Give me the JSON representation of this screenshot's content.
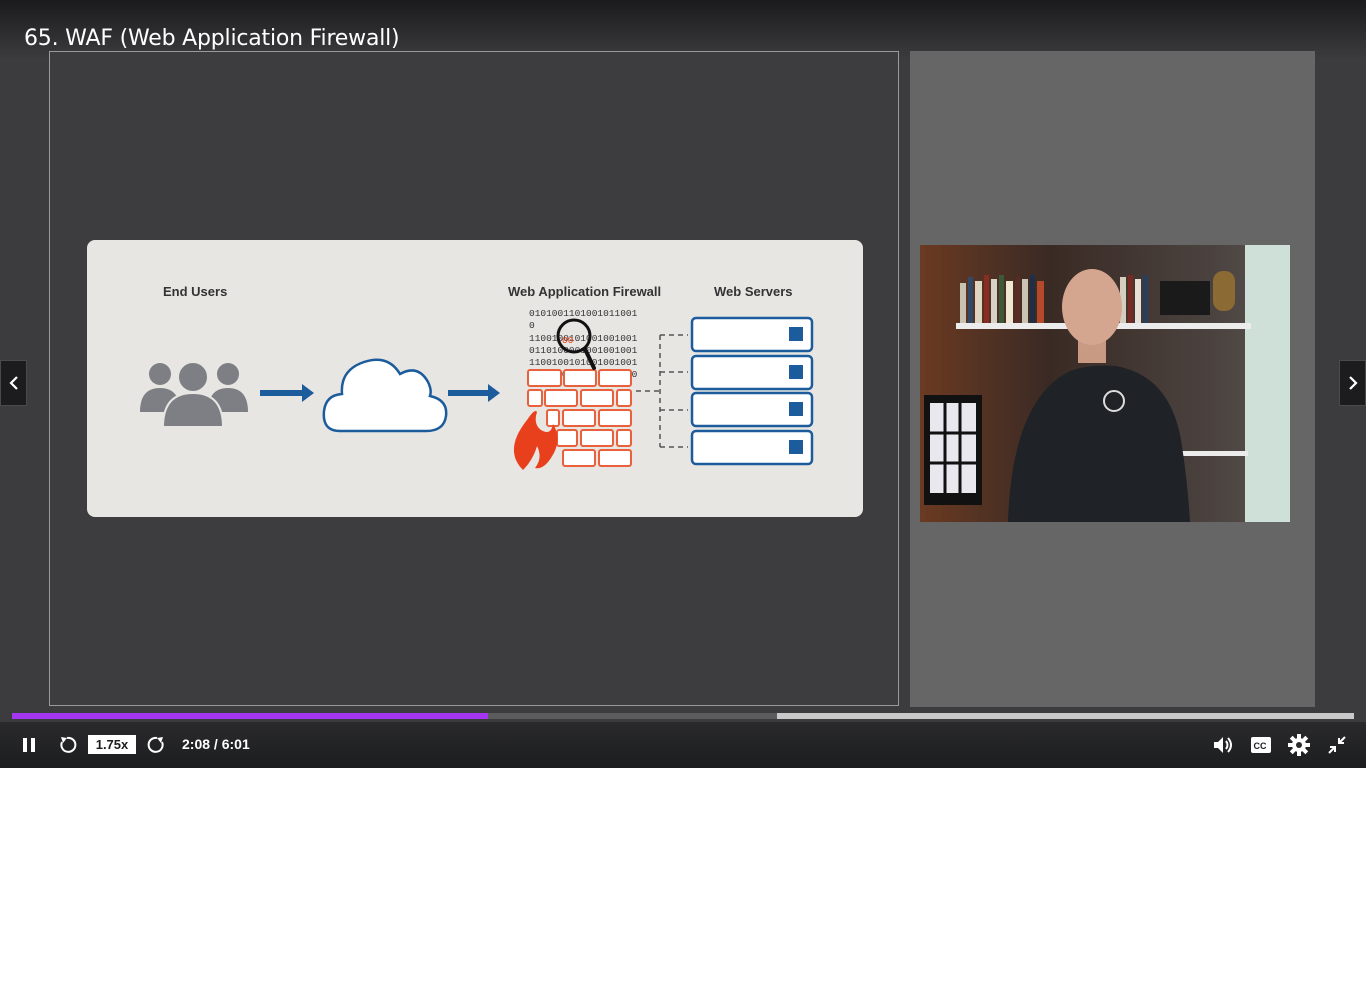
{
  "lecture": {
    "title": "65. WAF (Web Application Firewall)"
  },
  "slide": {
    "labels": {
      "end_users": "End Users",
      "waf": "Web Application Firewall",
      "web_servers": "Web Servers"
    },
    "binary_lines": [
      "0101001101001011001 0",
      "1100100101001001001",
      "0110100001001001001",
      "1100100101001001001",
      "1100100101010100100"
    ]
  },
  "player": {
    "playback_rate": "1.75x",
    "current_time": "2:08",
    "time_separator": " / ",
    "duration": "6:01",
    "progress_fraction": 0.355,
    "buffered_fraction": 0.57
  },
  "colors": {
    "accent": "#a435f0",
    "arrow_blue": "#1c5c9c",
    "brick_orange": "#e8603c",
    "server_blue": "#1c5c9c"
  },
  "icons": {
    "prev": "chevron-left-icon",
    "next": "chevron-right-icon",
    "pause": "pause-icon",
    "rewind": "rewind-5-icon",
    "forward": "forward-5-icon",
    "volume": "volume-icon",
    "captions": "captions-icon",
    "settings": "gear-icon",
    "exit_fullscreen": "exit-fullscreen-icon"
  }
}
